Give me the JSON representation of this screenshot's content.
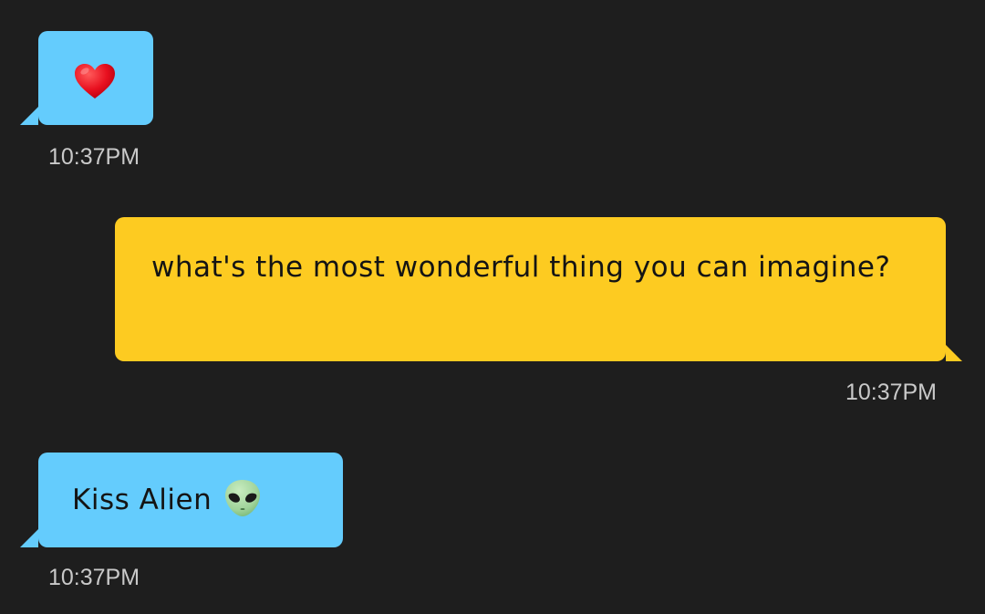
{
  "messages": [
    {
      "sender": "them",
      "icon": "heart-icon",
      "time": "10:37PM"
    },
    {
      "sender": "me",
      "text": "what's the most wonderful thing you can imagine?",
      "time": "10:37PM"
    },
    {
      "sender": "them",
      "text": "Kiss Alien",
      "icon": "alien-icon",
      "time": "10:37PM"
    }
  ],
  "colors": {
    "background": "#1e1e1e",
    "incoming_bubble": "#64ccfd",
    "outgoing_bubble": "#fdcb21",
    "timestamp": "#c9c9c9"
  }
}
